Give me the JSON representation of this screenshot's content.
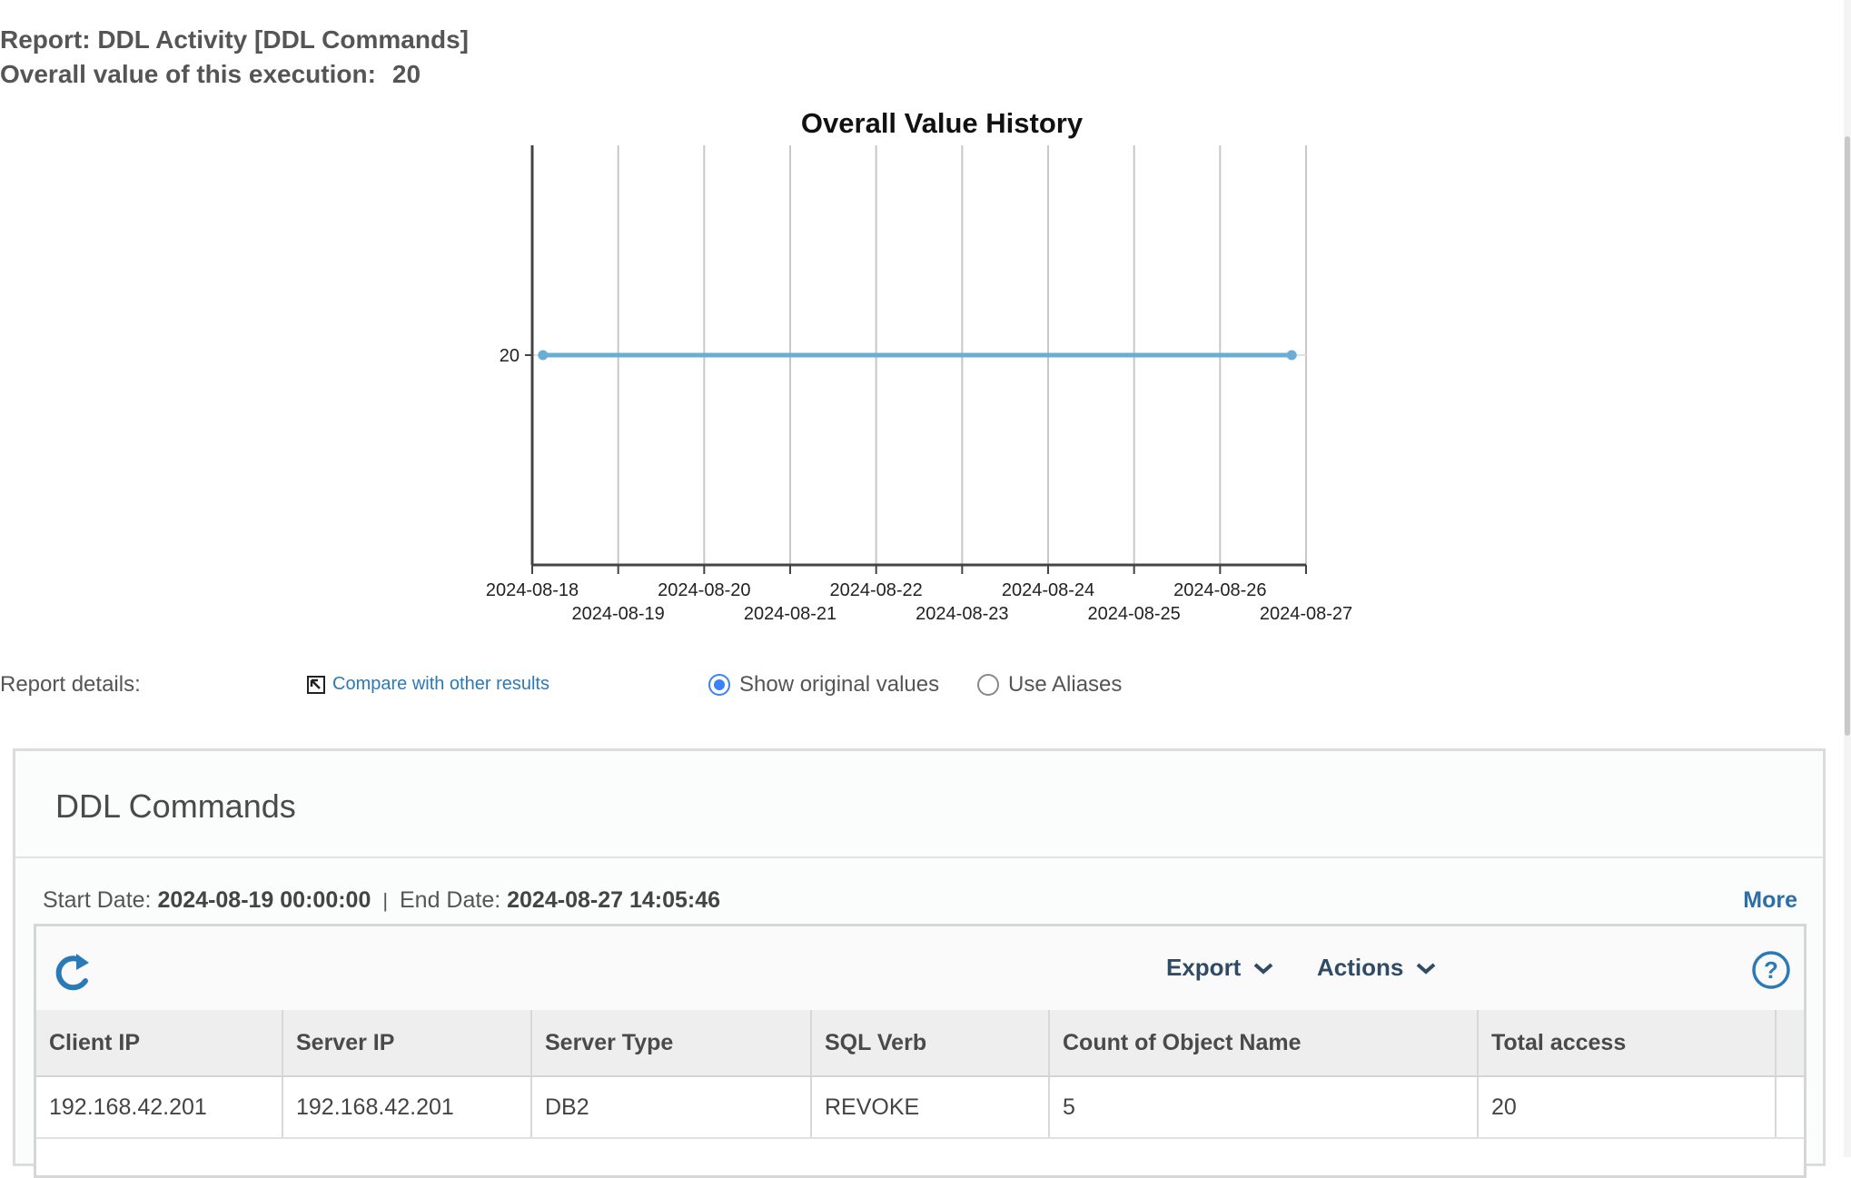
{
  "report": {
    "title": "Report: DDL Activity [DDL Commands]",
    "overall_label": "Overall value of this execution:",
    "overall_value": "20"
  },
  "chart_data": {
    "type": "line",
    "title": "Overall Value History",
    "x": [
      "2024-08-18",
      "2024-08-27"
    ],
    "series": [
      {
        "values": [
          20,
          20
        ]
      }
    ],
    "x_points_dates": [
      "2024-08-18 03:00",
      "2024-08-26 20:00"
    ],
    "x_ticks": [
      "2024-08-18",
      "2024-08-19",
      "2024-08-20",
      "2024-08-21",
      "2024-08-22",
      "2024-08-23",
      "2024-08-24",
      "2024-08-25",
      "2024-08-26",
      "2024-08-27"
    ],
    "y_ticks": [
      20
    ],
    "grid": "vertical",
    "color": "#6aaed6"
  },
  "details": {
    "label": "Report details:",
    "compare_link": "Compare with other results",
    "radio_original": "Show original values",
    "radio_aliases": "Use Aliases",
    "selected": "original"
  },
  "panel": {
    "title": "DDL Commands",
    "start_label": "Start Date:",
    "start_value": "2024-08-19 00:00:00",
    "separator": "|",
    "end_label": "End Date:",
    "end_value": "2024-08-27 14:05:46",
    "more": "More"
  },
  "toolbar": {
    "export": "Export",
    "actions": "Actions"
  },
  "table": {
    "headers": [
      "Client IP",
      "Server IP",
      "Server Type",
      "SQL Verb",
      "Count of Object Name",
      "Total access"
    ],
    "rows": [
      [
        "192.168.42.201",
        "192.168.42.201",
        "DB2",
        "REVOKE",
        "5",
        "20"
      ]
    ]
  },
  "colors": {
    "accent": "#3b82f6",
    "link": "#2a7ab8",
    "line": "#6aaed6"
  }
}
